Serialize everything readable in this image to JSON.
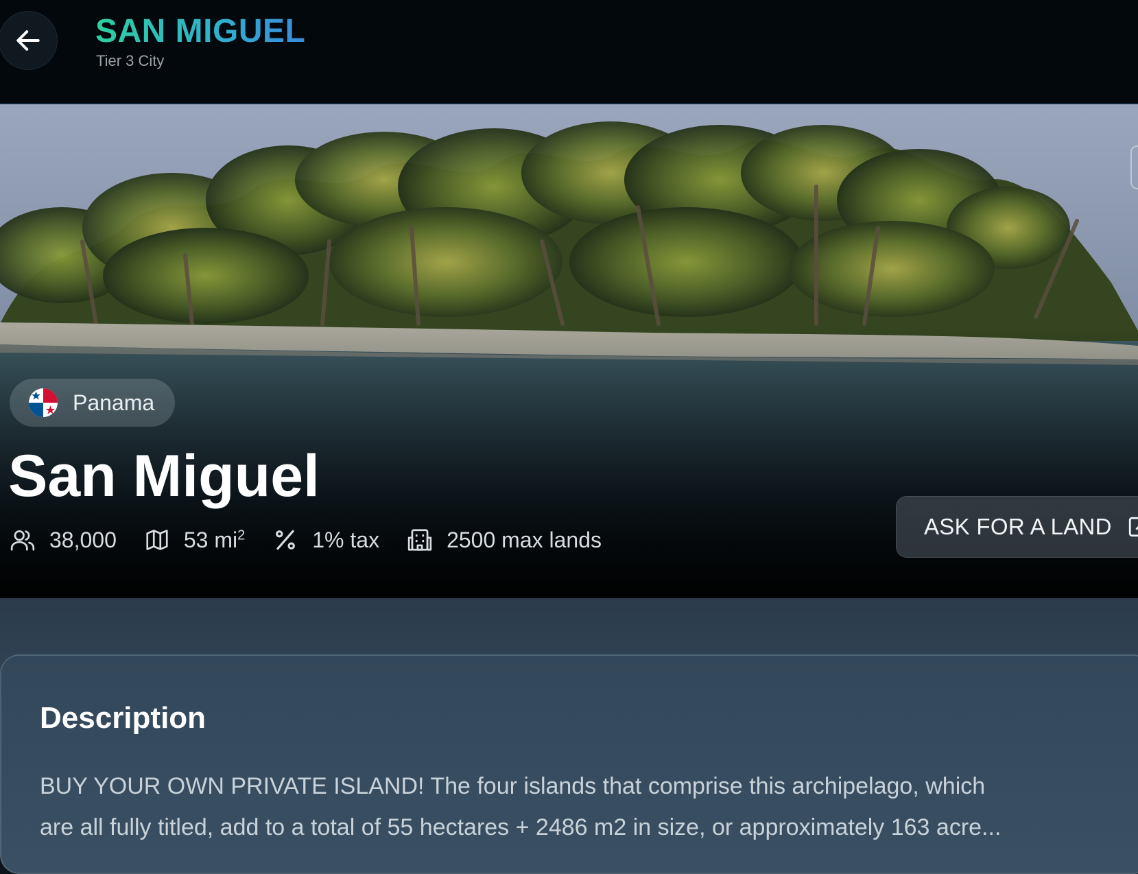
{
  "header": {
    "back_icon": "arrow-left-icon",
    "title": "SAN MIGUEL",
    "subtitle": "Tier 3 City",
    "title_gradient": [
      "#2ecfa0",
      "#2fb3cc",
      "#3a8bdc"
    ]
  },
  "hero": {
    "image_subject": "palm-tree island beach",
    "country": {
      "name": "Panama",
      "flag_icon": "panama-flag-icon"
    },
    "city_name": "San Miguel",
    "stats": {
      "population": {
        "icon": "users-icon",
        "value": "38,000"
      },
      "area": {
        "icon": "map-icon",
        "value": "53 mi",
        "unit_superscript": "2"
      },
      "tax": {
        "icon": "percent-icon",
        "value": "1% tax"
      },
      "max_lands": {
        "icon": "building-icon",
        "value": "2500 max lands"
      }
    },
    "cta": {
      "label": "ASK FOR A LAND",
      "icon": "external-link-icon"
    }
  },
  "description": {
    "heading": "Description",
    "lines": [
      "BUY YOUR OWN PRIVATE ISLAND! The four islands that comprise this archipelago, which",
      "are all fully titled, add to a total of 55 hectares + 2486 m2 in size, or approximately 163 acre..."
    ]
  }
}
